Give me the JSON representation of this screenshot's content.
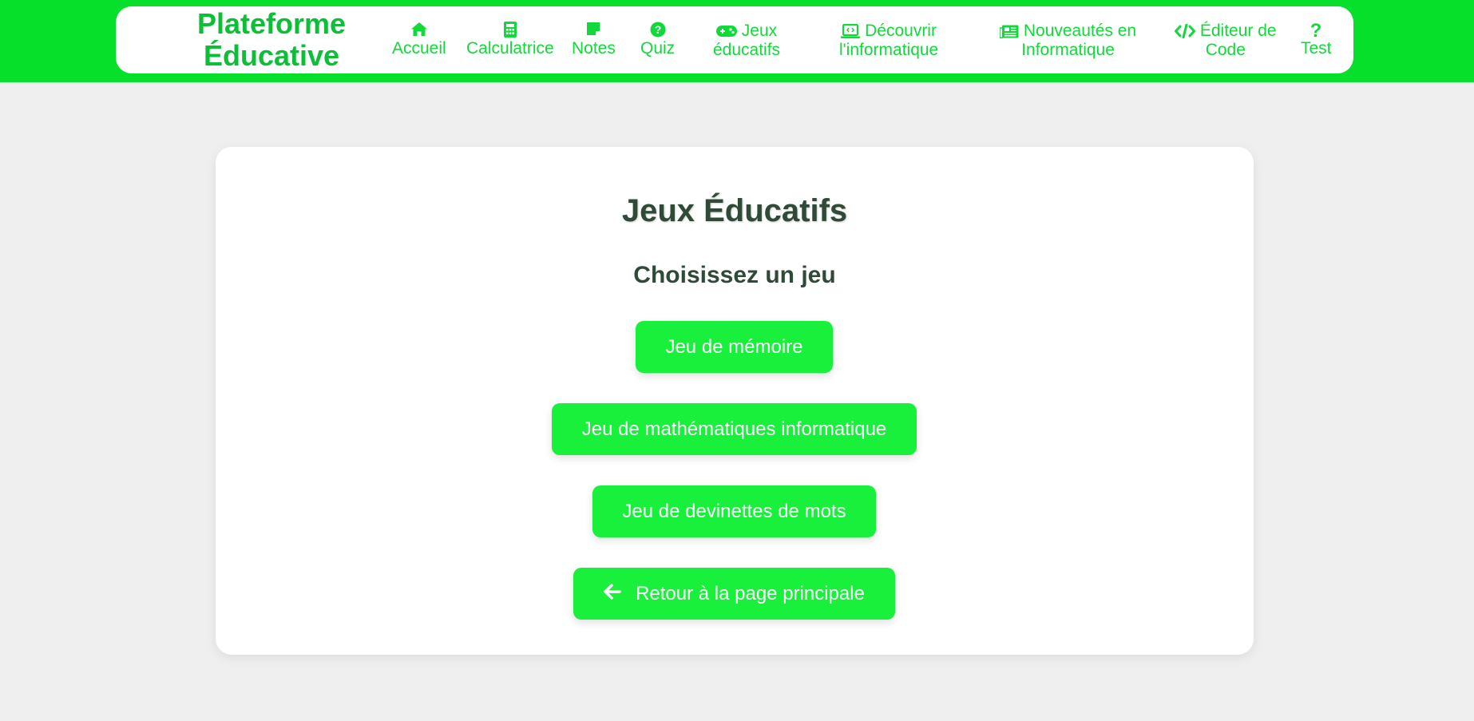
{
  "brand": {
    "line1": "Plateforme",
    "line2": "Éducative"
  },
  "nav": [
    {
      "label": "Accueil",
      "icon": "home-icon"
    },
    {
      "label": "Calculatrice",
      "icon": "calculator-icon"
    },
    {
      "label": "Notes",
      "icon": "sticky-note-icon"
    },
    {
      "label": "Quiz",
      "icon": "question-circle-icon"
    },
    {
      "label_line1": "Jeux",
      "label_line2": "éducatifs",
      "icon": "gamepad-icon"
    },
    {
      "label_line1": "Découvrir",
      "label_line2": "l'informatique",
      "icon": "laptop-code-icon"
    },
    {
      "label_line1": "Nouveautés en",
      "label_line2": "Informatique",
      "icon": "newspaper-icon"
    },
    {
      "label_line1": "Éditeur de",
      "label_line2": "Code",
      "icon": "code-icon"
    },
    {
      "label": "Test",
      "icon": "question-icon"
    }
  ],
  "main": {
    "title": "Jeux Éducatifs",
    "subtitle": "Choisissez un jeu",
    "buttons": [
      {
        "label": "Jeu de mémoire"
      },
      {
        "label": "Jeu de mathématiques informatique"
      },
      {
        "label": "Jeu de devinettes de mots"
      },
      {
        "label": "Retour à la page principale",
        "icon": "arrow-left-icon"
      }
    ]
  },
  "colors": {
    "topbar": "#06e02b",
    "accent": "#19f03c",
    "nav_text": "#12d93a",
    "heading": "#2f4a37",
    "background": "#efefef"
  }
}
